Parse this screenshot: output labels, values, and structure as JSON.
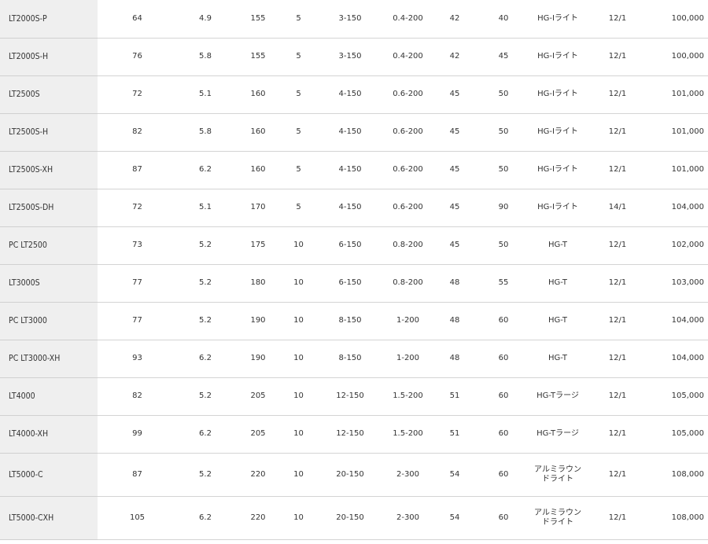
{
  "rows": [
    {
      "model": "LT2000S-P",
      "c1": "64",
      "c2": "4.9",
      "c3": "155",
      "c4": "5",
      "c5": "3-150",
      "c6": "0.4-200",
      "c7": "42",
      "c8": "40",
      "c9": "HG-Iライト",
      "c9b": "",
      "c10": "12/1",
      "c11": "100,000"
    },
    {
      "model": "LT2000S-H",
      "c1": "76",
      "c2": "5.8",
      "c3": "155",
      "c4": "5",
      "c5": "3-150",
      "c6": "0.4-200",
      "c7": "42",
      "c8": "45",
      "c9": "HG-Iライト",
      "c9b": "",
      "c10": "12/1",
      "c11": "100,000"
    },
    {
      "model": "LT2500S",
      "c1": "72",
      "c2": "5.1",
      "c3": "160",
      "c4": "5",
      "c5": "4-150",
      "c6": "0.6-200",
      "c7": "45",
      "c8": "50",
      "c9": "HG-Iライト",
      "c9b": "",
      "c10": "12/1",
      "c11": "101,000"
    },
    {
      "model": "LT2500S-H",
      "c1": "82",
      "c2": "5.8",
      "c3": "160",
      "c4": "5",
      "c5": "4-150",
      "c6": "0.6-200",
      "c7": "45",
      "c8": "50",
      "c9": "HG-Iライト",
      "c9b": "",
      "c10": "12/1",
      "c11": "101,000"
    },
    {
      "model": "LT2500S-XH",
      "c1": "87",
      "c2": "6.2",
      "c3": "160",
      "c4": "5",
      "c5": "4-150",
      "c6": "0.6-200",
      "c7": "45",
      "c8": "50",
      "c9": "HG-Iライト",
      "c9b": "",
      "c10": "12/1",
      "c11": "101,000"
    },
    {
      "model": "LT2500S-DH",
      "c1": "72",
      "c2": "5.1",
      "c3": "170",
      "c4": "5",
      "c5": "4-150",
      "c6": "0.6-200",
      "c7": "45",
      "c8": "90",
      "c9": "HG-Iライト",
      "c9b": "",
      "c10": "14/1",
      "c11": "104,000"
    },
    {
      "model": "PC LT2500",
      "c1": "73",
      "c2": "5.2",
      "c3": "175",
      "c4": "10",
      "c5": "6-150",
      "c6": "0.8-200",
      "c7": "45",
      "c8": "50",
      "c9": "HG-T",
      "c9b": "",
      "c10": "12/1",
      "c11": "102,000"
    },
    {
      "model": "LT3000S",
      "c1": "77",
      "c2": "5.2",
      "c3": "180",
      "c4": "10",
      "c5": "6-150",
      "c6": "0.8-200",
      "c7": "48",
      "c8": "55",
      "c9": "HG-T",
      "c9b": "",
      "c10": "12/1",
      "c11": "103,000"
    },
    {
      "model": "PC LT3000",
      "c1": "77",
      "c2": "5.2",
      "c3": "190",
      "c4": "10",
      "c5": "8-150",
      "c6": "1-200",
      "c7": "48",
      "c8": "60",
      "c9": "HG-T",
      "c9b": "",
      "c10": "12/1",
      "c11": "104,000"
    },
    {
      "model": "PC LT3000-XH",
      "c1": "93",
      "c2": "6.2",
      "c3": "190",
      "c4": "10",
      "c5": "8-150",
      "c6": "1-200",
      "c7": "48",
      "c8": "60",
      "c9": "HG-T",
      "c9b": "",
      "c10": "12/1",
      "c11": "104,000"
    },
    {
      "model": "LT4000",
      "c1": "82",
      "c2": "5.2",
      "c3": "205",
      "c4": "10",
      "c5": "12-150",
      "c6": "1.5-200",
      "c7": "51",
      "c8": "60",
      "c9": "HG-Tラージ",
      "c9b": "",
      "c10": "12/1",
      "c11": "105,000"
    },
    {
      "model": "LT4000-XH",
      "c1": "99",
      "c2": "6.2",
      "c3": "205",
      "c4": "10",
      "c5": "12-150",
      "c6": "1.5-200",
      "c7": "51",
      "c8": "60",
      "c9": "HG-Tラージ",
      "c9b": "",
      "c10": "12/1",
      "c11": "105,000"
    },
    {
      "model": "LT5000-C",
      "c1": "87",
      "c2": "5.2",
      "c3": "220",
      "c4": "10",
      "c5": "20-150",
      "c6": "2-300",
      "c7": "54",
      "c8": "60",
      "c9": "アルミラウン",
      "c9b": "ドライト",
      "c10": "12/1",
      "c11": "108,000"
    },
    {
      "model": "LT5000-CXH",
      "c1": "105",
      "c2": "6.2",
      "c3": "220",
      "c4": "10",
      "c5": "20-150",
      "c6": "2-300",
      "c7": "54",
      "c8": "60",
      "c9": "アルミラウン",
      "c9b": "ドライト",
      "c10": "12/1",
      "c11": "108,000"
    }
  ]
}
